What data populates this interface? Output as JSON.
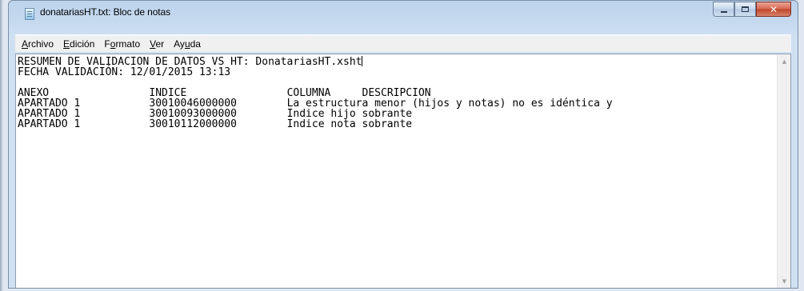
{
  "window": {
    "title": "donatariasHT.txt: Bloc de notas"
  },
  "caption_buttons": {
    "minimize_icon": "minimize-icon",
    "maximize_icon": "maximize-icon",
    "close_glyph": "✕"
  },
  "menu": {
    "items": [
      {
        "label_u": "A",
        "label_rest": "rchivo"
      },
      {
        "label_u": "E",
        "label_rest": "dición"
      },
      {
        "label_pre": "F",
        "label_u": "o",
        "label_rest": "rmato"
      },
      {
        "label_u": "V",
        "label_rest": "er"
      },
      {
        "label_pre": "Ay",
        "label_u": "u",
        "label_rest": "da"
      }
    ]
  },
  "document": {
    "line1": "RESUMEN DE VALIDACIÓN DE DATOS VS HT: DonatariasHT.xsht",
    "line2": "FECHA VALIDACIÓN: 12/01/2015 13:13",
    "header": {
      "anexo": "ANEXO",
      "indice": "INDICE",
      "columna": "COLUMNA",
      "descripcion": "DESCRIPCION"
    },
    "rows": [
      {
        "anexo": "APARTADO 1",
        "indice": "30010046000000",
        "text": "La estructura menor (hijos y notas) no es idéntica y"
      },
      {
        "anexo": "APARTADO 1",
        "indice": "30010093000000",
        "text": "Indice hijo sobrante"
      },
      {
        "anexo": "APARTADO 1",
        "indice": "30010112000000",
        "text": "Indice nota sobrante"
      }
    ]
  },
  "scrollbar": {
    "up_icon": "▲",
    "down_icon": "▼"
  },
  "colors": {
    "titlebar": "#bcd3ec",
    "close_button": "#c2432a",
    "editor_bg": "#ffffff"
  }
}
